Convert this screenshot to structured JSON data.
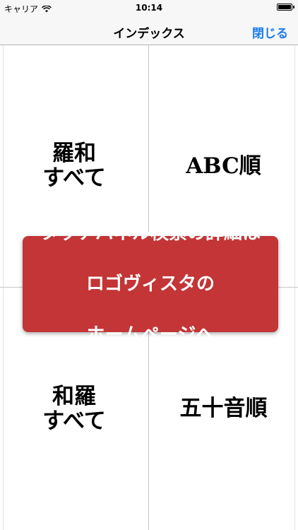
{
  "status_bar": {
    "carrier": "キャリア",
    "time": "10:14",
    "wifi_icon": "wifi-icon",
    "battery_icon": "battery-icon"
  },
  "nav": {
    "title": "インデックス",
    "close_label": "閉じる",
    "accent_color": "#1a7cf0"
  },
  "grid": {
    "cells": [
      {
        "label": "羅和\nすべて"
      },
      {
        "label": "ABC順"
      },
      {
        "label": "和羅\nすべて"
      },
      {
        "label": "五十音順"
      }
    ]
  },
  "banner": {
    "line1": "タッチパネル検索の詳細は",
    "line2": "ロゴヴィスタの",
    "line3": "ホームページへ",
    "color": "#c33536"
  }
}
